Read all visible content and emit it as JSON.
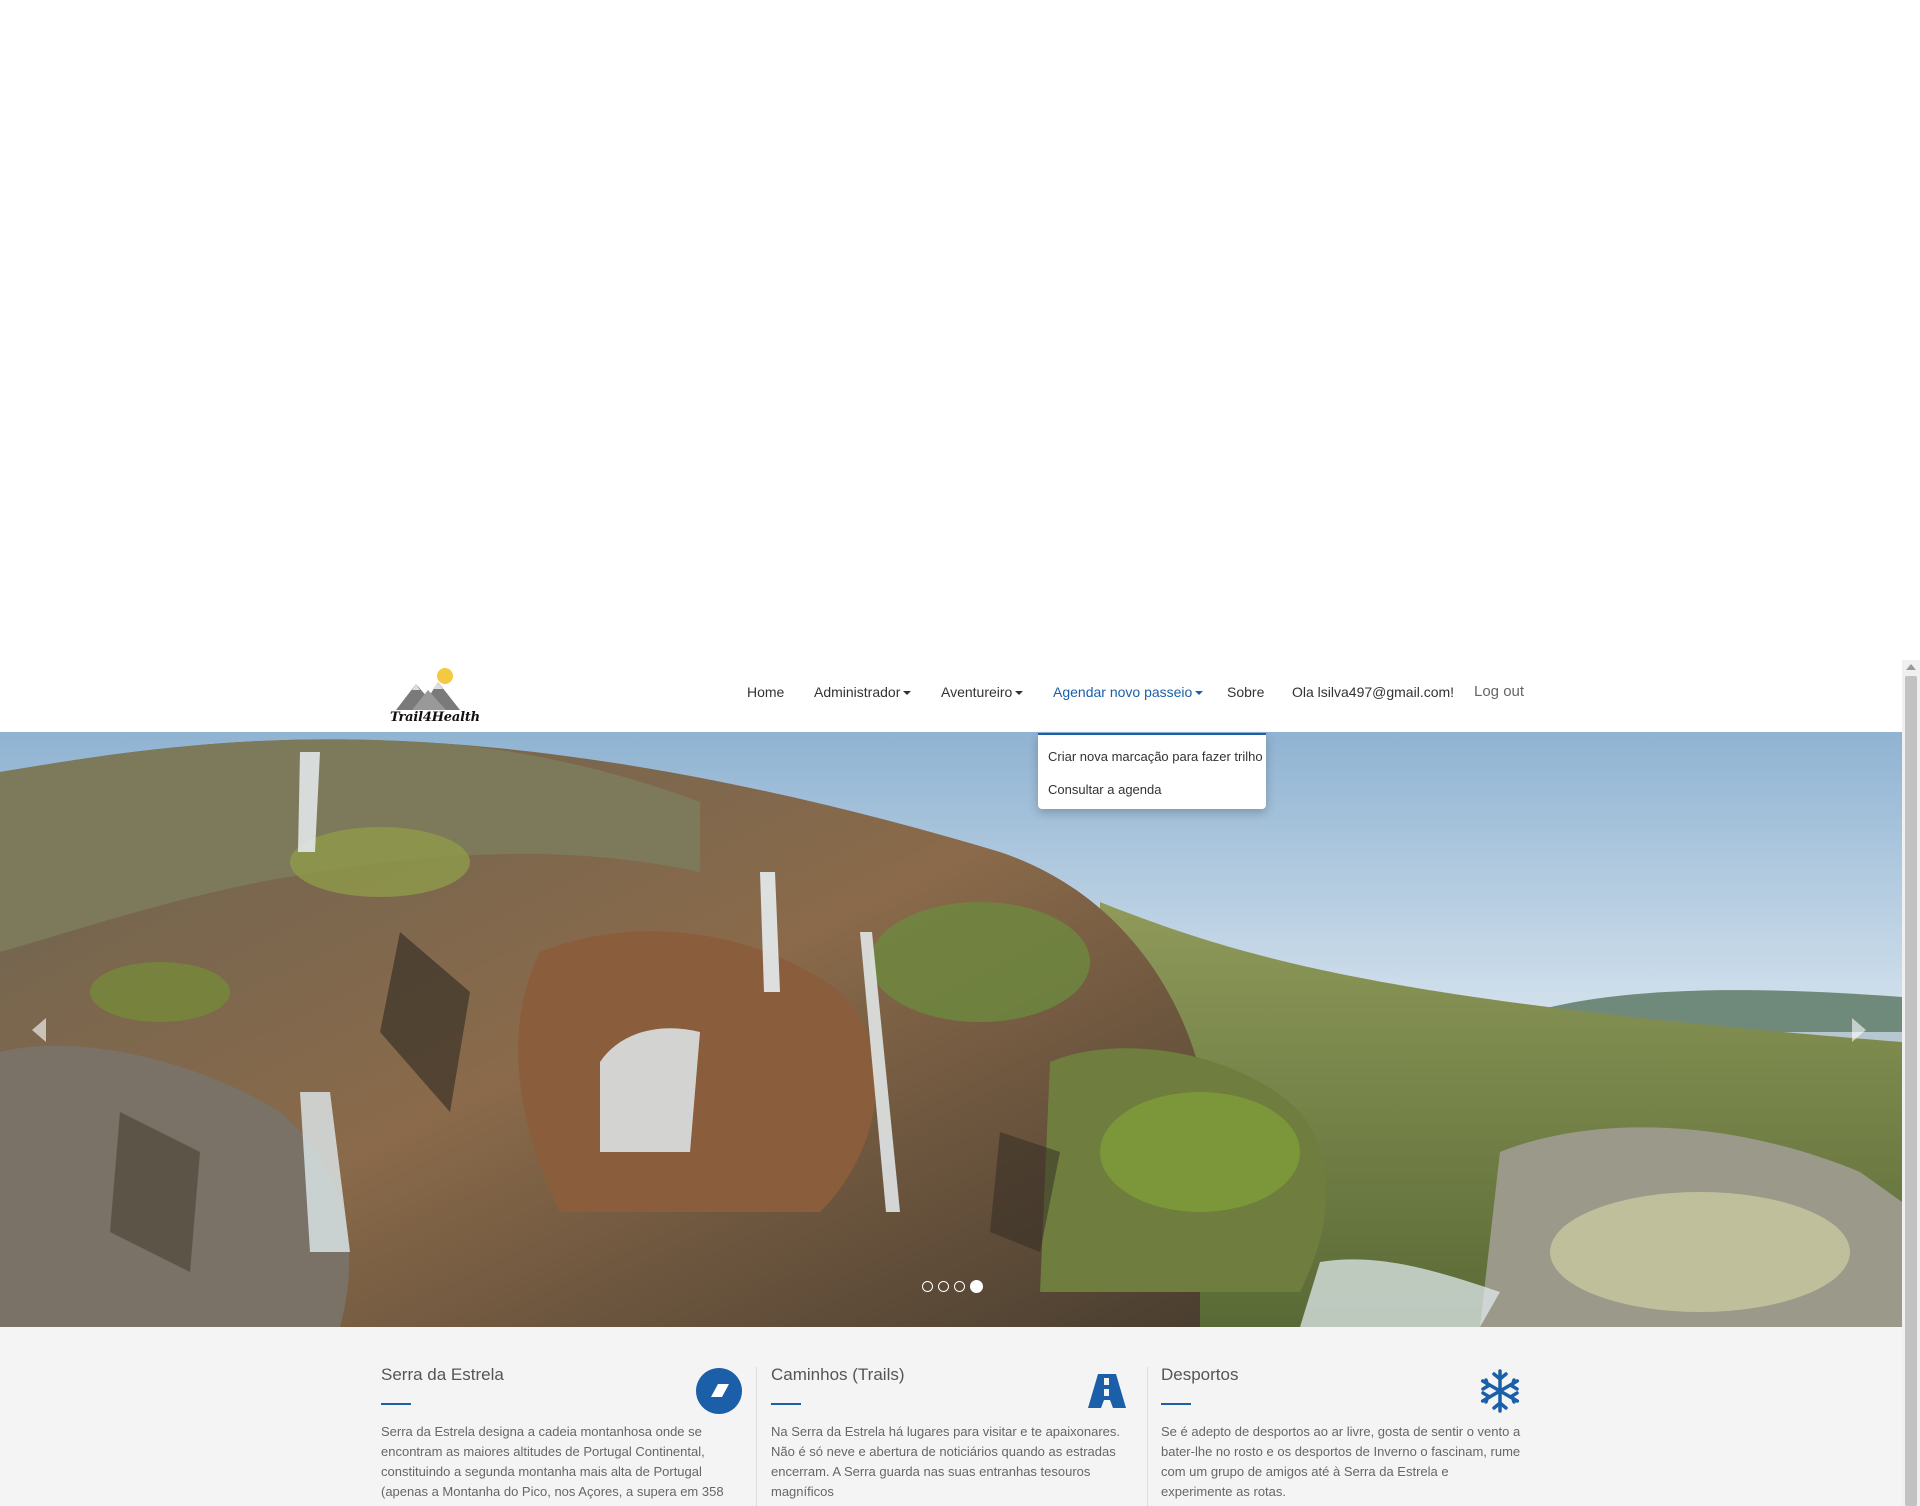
{
  "brand": {
    "logo_text": "Trail4Health"
  },
  "nav": {
    "items": [
      {
        "label": "Home"
      },
      {
        "label": "Administrador"
      },
      {
        "label": "Aventureiro"
      },
      {
        "label": "Agendar novo passeio"
      },
      {
        "label": "Sobre"
      },
      {
        "label": "Ola lsilva497@gmail.com!"
      },
      {
        "label": "Log out"
      }
    ],
    "active": "Agendar novo passeio"
  },
  "dropdown": {
    "items": [
      {
        "label": "Criar nova marcação para fazer trilho"
      },
      {
        "label": "Consultar a agenda"
      }
    ]
  },
  "carousel": {
    "slide_count": 4,
    "active_index": 3
  },
  "features": [
    {
      "title": "Serra da Estrela",
      "text": "Serra da Estrela designa a cadeia montanhosa onde se encontram as maiores altitudes de Portugal Continental, constituindo a segunda montanha mais alta de Portugal (apenas a Montanha do Pico, nos Açores, a supera em 358",
      "icon": "eraser-icon"
    },
    {
      "title": "Caminhos (Trails)",
      "text": "Na Serra da Estrela há lugares para visitar e te apaixonares. Não é só neve e abertura de noticiários quando as estradas encerram. A Serra guarda nas suas entranhas tesouros magníficos",
      "icon": "road-icon"
    },
    {
      "title": "Desportos",
      "text": "Se é adepto de desportos ao ar livre, gosta de sentir o vento a bater-lhe no rosto e os desportos de Inverno o fascinam, rume com um grupo de amigos até à Serra da Estrela e experimente as rotas.",
      "icon": "snowflake-icon"
    }
  ],
  "colors": {
    "accent": "#1a5fa8",
    "features_bg": "#f4f4f4"
  }
}
